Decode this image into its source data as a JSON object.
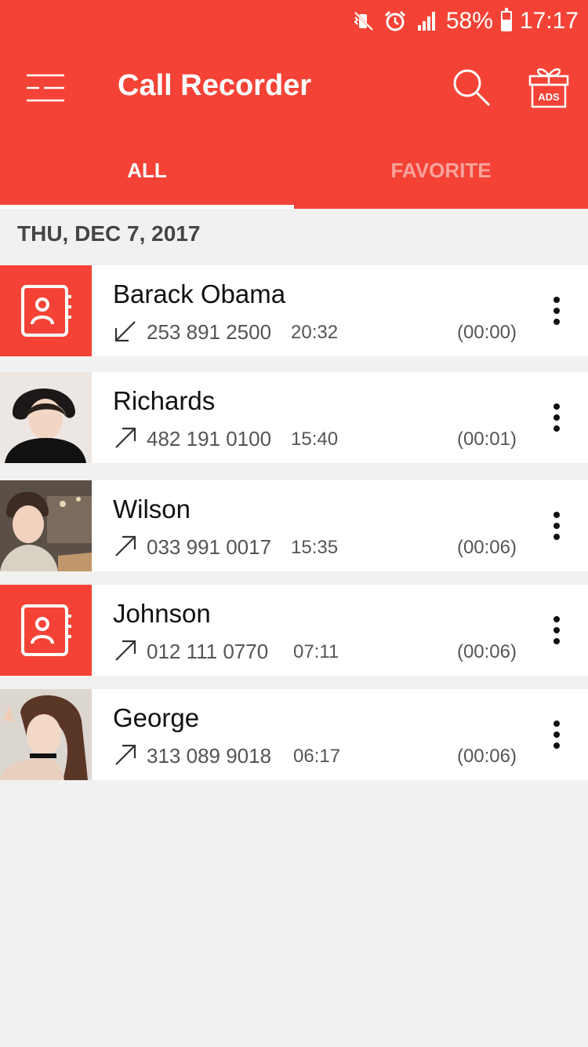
{
  "status_bar": {
    "battery_percent": "58%",
    "time": "17:17",
    "battery_level": 0.58,
    "icons": [
      "vibrate-mute-icon",
      "alarm-icon",
      "signal-icon",
      "battery-icon"
    ]
  },
  "toolbar": {
    "title": "Call Recorder",
    "ads_label": "ADS",
    "icons": [
      "menu-icon",
      "search-icon",
      "gift-ads-icon"
    ]
  },
  "tabs": [
    {
      "label": "ALL",
      "active": true
    },
    {
      "label": "FAVORITE",
      "active": false
    }
  ],
  "date_header": "THU, DEC 7, 2017",
  "colors": {
    "accent": "#f44336",
    "background": "#f1f1f1",
    "inactive_tab": "#f7a39c"
  },
  "calls": [
    {
      "name": "Barack Obama",
      "direction": "incoming",
      "number": "253 891 2500",
      "time": "20:32",
      "duration": "(00:00)",
      "avatar": "contact-placeholder"
    },
    {
      "name": "Richards",
      "direction": "outgoing",
      "number": "482 191 0100",
      "time": "15:40",
      "duration": "(00:01)",
      "avatar": "photo"
    },
    {
      "name": "Wilson",
      "direction": "outgoing",
      "number": "033 991 0017",
      "time": "15:35",
      "duration": "(00:06)",
      "avatar": "photo"
    },
    {
      "name": "Johnson",
      "direction": "outgoing",
      "number": "012 111 0770",
      "time": "07:11",
      "duration": "(00:06)",
      "avatar": "contact-placeholder"
    },
    {
      "name": "George",
      "direction": "outgoing",
      "number": "313 089 9018",
      "time": "06:17",
      "duration": "(00:06)",
      "avatar": "photo"
    }
  ]
}
